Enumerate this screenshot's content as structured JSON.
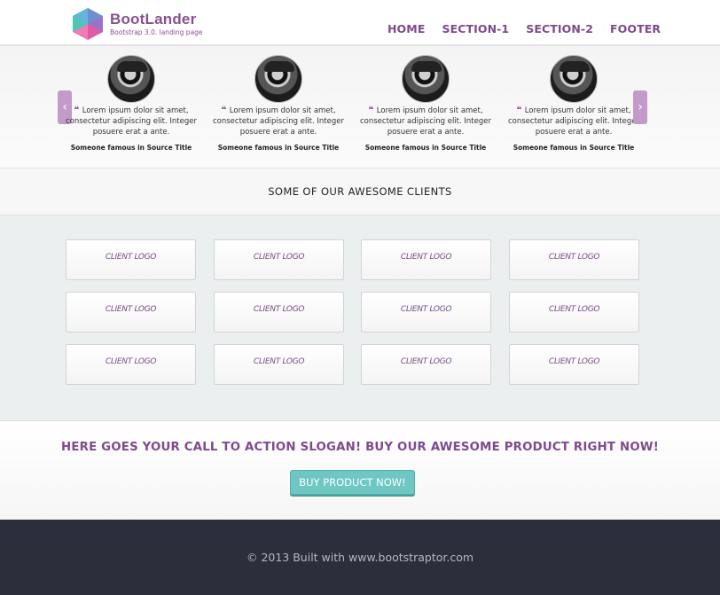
{
  "header": {
    "brand_name": "BootLander",
    "brand_tagline": "Bootstrap 3.0. landing page",
    "nav": [
      "HOME",
      "SECTION-1",
      "SECTION-2",
      "FOOTER"
    ]
  },
  "testimonials": {
    "prev_label": "‹",
    "next_label": "›",
    "items": [
      {
        "quote": "Lorem ipsum dolor sit amet, consectetur adipiscing elit. Integer posuere erat a ante.",
        "source": "Someone famous in Source Title"
      },
      {
        "quote": "Lorem ipsum dolor sit amet, consectetur adipiscing elit. Integer posuere erat a ante.",
        "source": "Someone famous in Source Title"
      },
      {
        "quote": "Lorem ipsum dolor sit amet, consectetur adipiscing elit. Integer posuere erat a ante.",
        "source": "Someone famous in Source Title"
      },
      {
        "quote": "Lorem ipsum dolor sit amet, consectetur adipiscing elit. Integer posuere erat a ante.",
        "source": "Someone famous in Source Title"
      }
    ]
  },
  "clients": {
    "heading": "SOME OF OUR AWESOME CLIENTS",
    "logos": [
      "CLIENT LOGO",
      "CLIENT LOGO",
      "CLIENT LOGO",
      "CLIENT LOGO",
      "CLIENT LOGO",
      "CLIENT LOGO",
      "CLIENT LOGO",
      "CLIENT LOGO",
      "CLIENT LOGO",
      "CLIENT LOGO",
      "CLIENT LOGO",
      "CLIENT LOGO"
    ]
  },
  "cta": {
    "slogan": "HERE GOES YOUR CALL TO ACTION SLOGAN! BUY OUR AWESOME PRODUCT RIGHT NOW!",
    "button": "BUY PRODUCT NOW!"
  },
  "footer": {
    "text": "© 2013 Built with www.bootstraptor.com"
  },
  "colors": {
    "brand": "#8a4f92",
    "accent": "#6ec7c3",
    "footer_bg": "#2d2e3b"
  }
}
